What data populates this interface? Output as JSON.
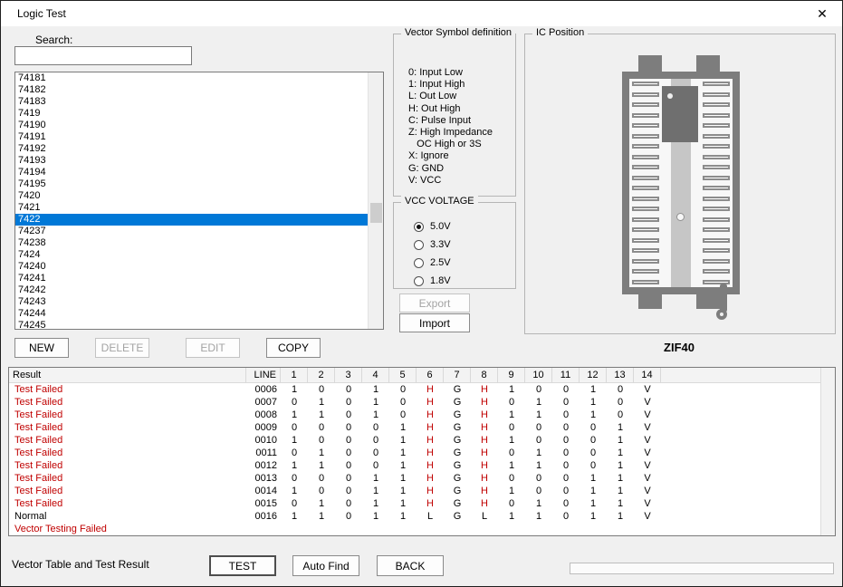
{
  "window": {
    "title": "Logic Test",
    "close_glyph": "✕"
  },
  "search": {
    "label": "Search:",
    "value": ""
  },
  "device_list": {
    "items": [
      "74181",
      "74182",
      "74183",
      "7419",
      "74190",
      "74191",
      "74192",
      "74193",
      "74194",
      "74195",
      "7420",
      "7421",
      "7422",
      "74237",
      "74238",
      "7424",
      "74240",
      "74241",
      "74242",
      "74243",
      "74244",
      "74245"
    ],
    "selected": "7422"
  },
  "list_buttons": {
    "new": "NEW",
    "delete": "DELETE",
    "edit": "EDIT",
    "copy": "COPY"
  },
  "vector_symbols": {
    "title": "Vector Symbol definition",
    "lines": [
      "0: Input Low",
      "1: Input High",
      "L: Out Low",
      "H: Out High",
      "C: Pulse Input",
      "Z: High Impedance",
      "   OC High or 3S",
      "X: Ignore",
      "G: GND",
      "V: VCC"
    ]
  },
  "vcc_voltage": {
    "title": "VCC VOLTAGE",
    "options": [
      "5.0V",
      "3.3V",
      "2.5V",
      "1.8V"
    ],
    "selected": "5.0V"
  },
  "io_buttons": {
    "export": "Export",
    "import": "Import"
  },
  "ic_position": {
    "title": "IC Position",
    "socket_label": "ZIF40",
    "pins_per_side": 20
  },
  "result_table": {
    "columns": [
      "Result",
      "LINE",
      "1",
      "2",
      "3",
      "4",
      "5",
      "6",
      "7",
      "8",
      "9",
      "10",
      "11",
      "12",
      "13",
      "14"
    ],
    "rows": [
      {
        "result": "Test Failed",
        "line": "0006",
        "status": "failed",
        "values": [
          "1",
          "0",
          "0",
          "1",
          "0",
          "H",
          "G",
          "H",
          "1",
          "0",
          "0",
          "1",
          "0",
          "V"
        ]
      },
      {
        "result": "Test Failed",
        "line": "0007",
        "status": "failed",
        "values": [
          "0",
          "1",
          "0",
          "1",
          "0",
          "H",
          "G",
          "H",
          "0",
          "1",
          "0",
          "1",
          "0",
          "V"
        ]
      },
      {
        "result": "Test Failed",
        "line": "0008",
        "status": "failed",
        "values": [
          "1",
          "1",
          "0",
          "1",
          "0",
          "H",
          "G",
          "H",
          "1",
          "1",
          "0",
          "1",
          "0",
          "V"
        ]
      },
      {
        "result": "Test Failed",
        "line": "0009",
        "status": "failed",
        "values": [
          "0",
          "0",
          "0",
          "0",
          "1",
          "H",
          "G",
          "H",
          "0",
          "0",
          "0",
          "0",
          "1",
          "V"
        ]
      },
      {
        "result": "Test Failed",
        "line": "0010",
        "status": "failed",
        "values": [
          "1",
          "0",
          "0",
          "0",
          "1",
          "H",
          "G",
          "H",
          "1",
          "0",
          "0",
          "0",
          "1",
          "V"
        ]
      },
      {
        "result": "Test Failed",
        "line": "0011",
        "status": "failed",
        "values": [
          "0",
          "1",
          "0",
          "0",
          "1",
          "H",
          "G",
          "H",
          "0",
          "1",
          "0",
          "0",
          "1",
          "V"
        ]
      },
      {
        "result": "Test Failed",
        "line": "0012",
        "status": "failed",
        "values": [
          "1",
          "1",
          "0",
          "0",
          "1",
          "H",
          "G",
          "H",
          "1",
          "1",
          "0",
          "0",
          "1",
          "V"
        ]
      },
      {
        "result": "Test Failed",
        "line": "0013",
        "status": "failed",
        "values": [
          "0",
          "0",
          "0",
          "1",
          "1",
          "H",
          "G",
          "H",
          "0",
          "0",
          "0",
          "1",
          "1",
          "V"
        ]
      },
      {
        "result": "Test Failed",
        "line": "0014",
        "status": "failed",
        "values": [
          "1",
          "0",
          "0",
          "1",
          "1",
          "H",
          "G",
          "H",
          "1",
          "0",
          "0",
          "1",
          "1",
          "V"
        ]
      },
      {
        "result": "Test Failed",
        "line": "0015",
        "status": "failed",
        "values": [
          "0",
          "1",
          "0",
          "1",
          "1",
          "H",
          "G",
          "H",
          "0",
          "1",
          "0",
          "1",
          "1",
          "V"
        ]
      },
      {
        "result": "Normal",
        "line": "0016",
        "status": "normal",
        "values": [
          "1",
          "1",
          "0",
          "1",
          "1",
          "L",
          "G",
          "L",
          "1",
          "1",
          "0",
          "1",
          "1",
          "V"
        ]
      }
    ],
    "footer_row": "Vector Testing Failed"
  },
  "status_bar": {
    "label": "Vector Table and Test Result",
    "test": "TEST",
    "auto_find": "Auto Find",
    "back": "BACK"
  },
  "colors": {
    "selection": "#0078d7",
    "failed_text": "#c00000",
    "socket_gray": "#7d7d7d"
  }
}
